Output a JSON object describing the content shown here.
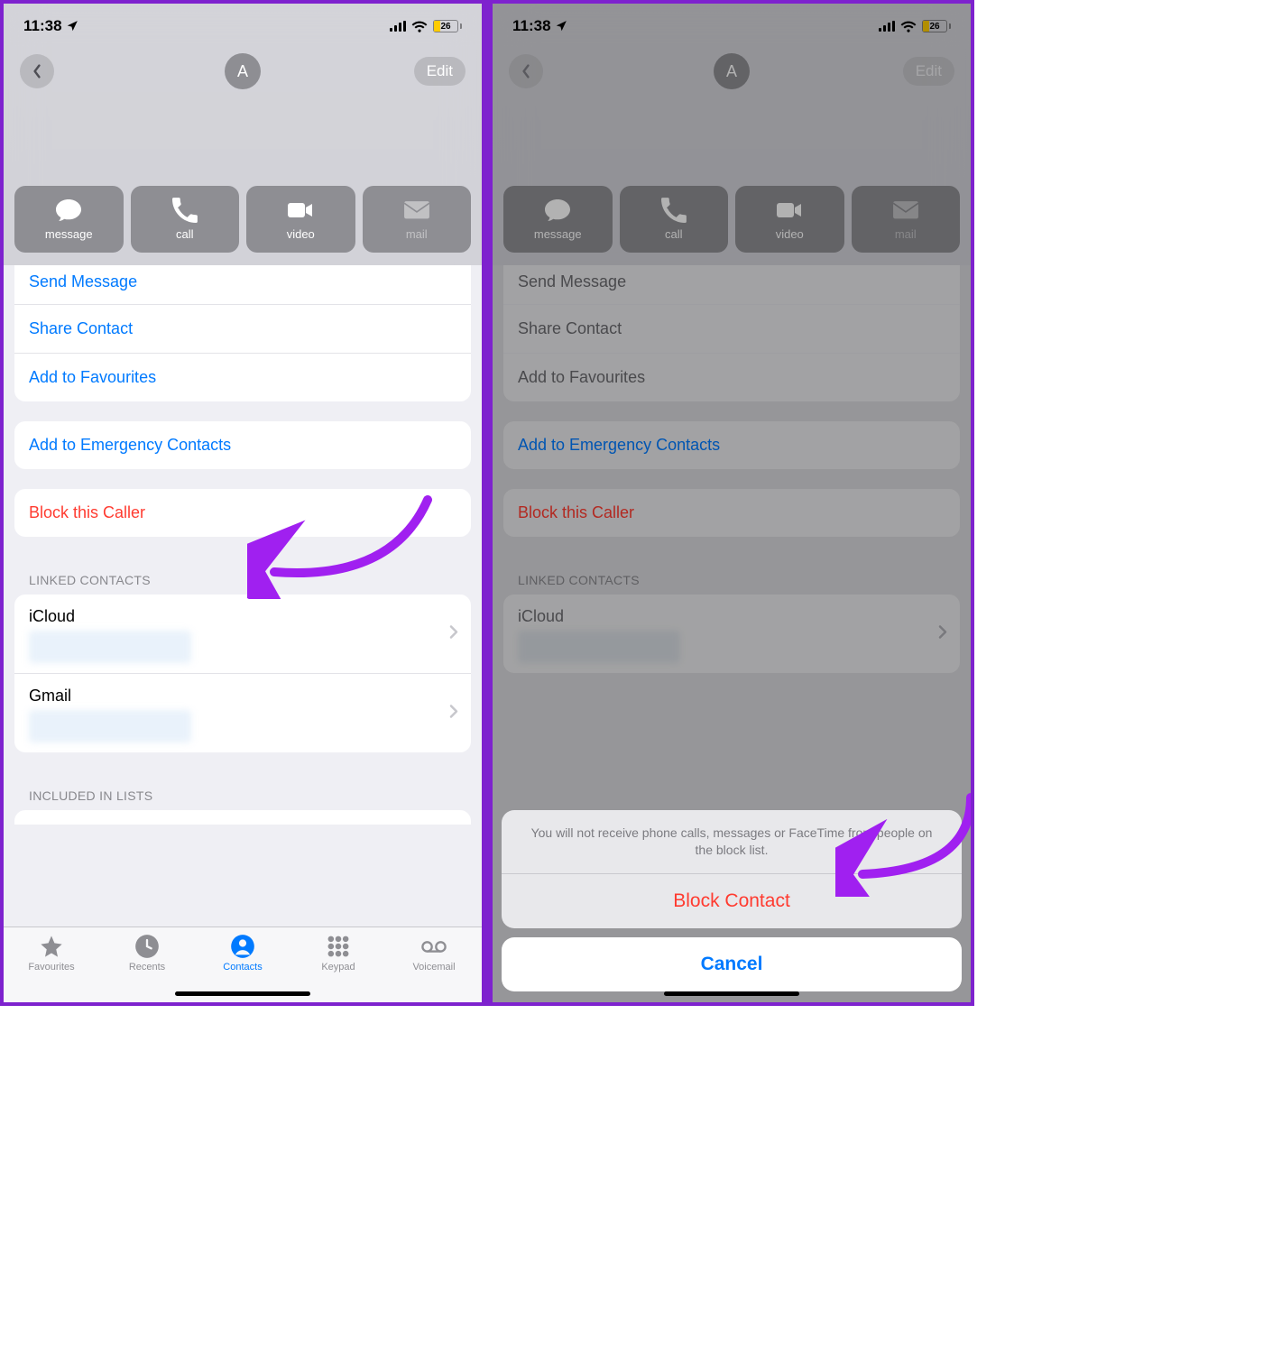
{
  "status": {
    "time": "11:38",
    "battery": "26"
  },
  "nav": {
    "avatar_initial": "A",
    "edit": "Edit"
  },
  "chips": {
    "message": "message",
    "call": "call",
    "video": "video",
    "mail": "mail"
  },
  "rows": {
    "send_message_cut": "Send Message",
    "share_contact": "Share Contact",
    "add_favourites": "Add to Favourites",
    "add_emergency": "Add to Emergency Contacts",
    "block_caller": "Block this Caller"
  },
  "sections": {
    "linked": "LINKED CONTACTS",
    "icloud": "iCloud",
    "gmail": "Gmail",
    "included": "INCLUDED IN LISTS"
  },
  "tabs": {
    "favourites": "Favourites",
    "recents": "Recents",
    "contacts": "Contacts",
    "keypad": "Keypad",
    "voicemail": "Voicemail"
  },
  "sheet": {
    "message": "You will not receive phone calls, messages or FaceTime from people on the block list.",
    "block": "Block Contact",
    "cancel": "Cancel"
  }
}
